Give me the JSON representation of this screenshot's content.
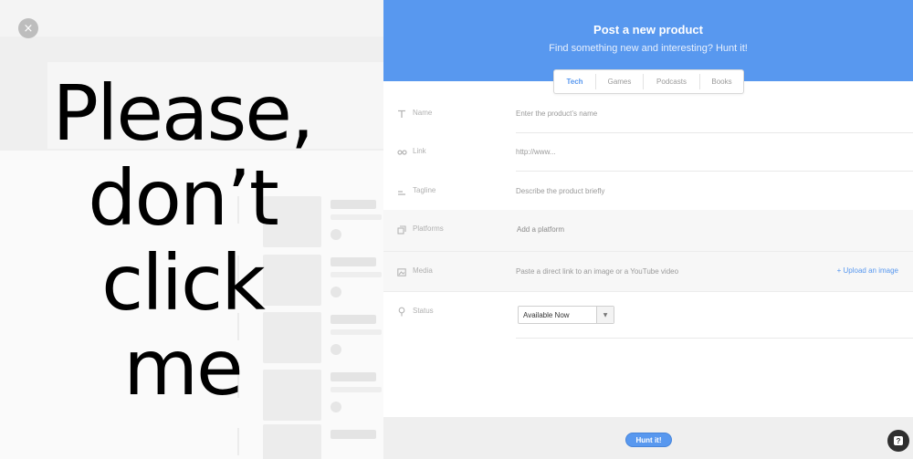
{
  "overlay": {
    "close_icon_glyph": "×",
    "big_message": "Please,\ndon’t\nclick\nme"
  },
  "modal": {
    "title": "Post a new product",
    "subtitle": "Find something new and interesting? Hunt it!",
    "accent_color": "#5898ef",
    "tabs": [
      {
        "label": "Tech",
        "active": true
      },
      {
        "label": "Games",
        "active": false
      },
      {
        "label": "Podcasts",
        "active": false
      },
      {
        "label": "Books",
        "active": false
      }
    ],
    "fields": {
      "name": {
        "label": "Name",
        "icon": "text-icon",
        "placeholder": "Enter the product’s name"
      },
      "link": {
        "label": "Link",
        "icon": "link-icon",
        "placeholder": "http://www..."
      },
      "tagline": {
        "label": "Tagline",
        "icon": "tagline-icon",
        "placeholder": "Describe the product briefly"
      },
      "platforms": {
        "label": "Platforms",
        "icon": "platforms-icon",
        "placeholder": "Add a platform"
      },
      "media": {
        "label": "Media",
        "icon": "image-icon",
        "placeholder": "Paste a direct link to an image or a YouTube video",
        "upload_link": "+ Upload an image"
      },
      "status": {
        "label": "Status",
        "icon": "pin-icon",
        "value": "Available Now"
      }
    },
    "submit_label": "Hunt it!"
  },
  "help": {
    "glyph": "?"
  }
}
